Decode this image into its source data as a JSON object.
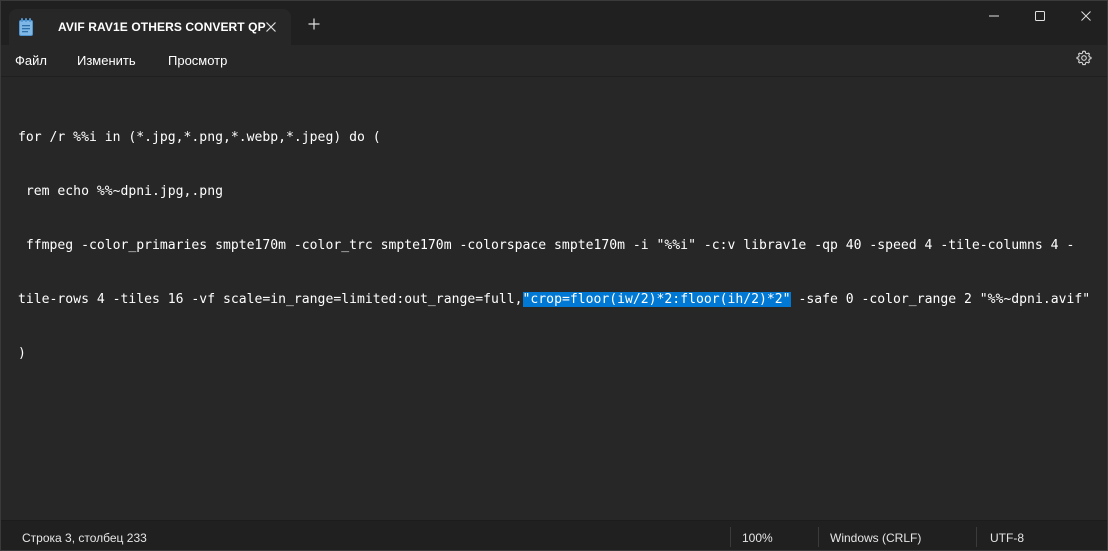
{
  "window": {
    "tab_title": "AVIF RAV1E OTHERS CONVERT QP",
    "tab_icon": "notepad-icon",
    "close_tab_icon": "close-icon",
    "new_tab_icon": "plus-icon",
    "controls": [
      "minimize-icon",
      "maximize-icon",
      "close-icon"
    ]
  },
  "menu": {
    "file": "Файл",
    "edit": "Изменить",
    "view": "Просмотр",
    "settings_icon": "gear-icon"
  },
  "editor": {
    "line1": "for /r %%i in (*.jpg,*.png,*.webp,*.jpeg) do (",
    "line2": " rem echo %%~dpni.jpg,.png",
    "line3": " ffmpeg -color_primaries smpte170m -color_trc smpte170m -colorspace smpte170m -i \"%%i\" -c:v librav1e -qp 40 -speed 4 -tile-columns 4 -",
    "line4_before": "tile-rows 4 -tiles 16 -vf scale=in_range=limited:out_range=full,",
    "line4_selected": "\"crop=floor(iw/2)*2:floor(ih/2)*2\"",
    "line4_after": " -safe 0 -color_range 2 \"%%~dpni.avif\"",
    "line5": ")",
    "selection_color": "#0078d4"
  },
  "status": {
    "position": "Строка 3, столбец 233",
    "zoom": "100%",
    "line_ending": "Windows (CRLF)",
    "encoding": "UTF-8"
  },
  "colors": {
    "background": "#272727",
    "titlebar": "#202020",
    "text": "#ffffff",
    "accent": "#0078d4"
  }
}
